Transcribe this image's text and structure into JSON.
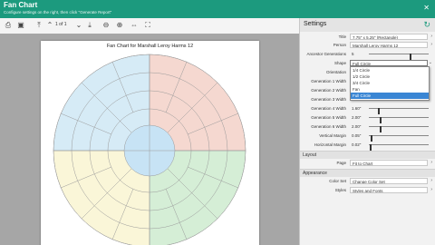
{
  "window": {
    "title": "Fan Chart",
    "subtitle": "Configure settings on the right, then click \"Generate Report\""
  },
  "toolbar": {
    "page_label": "1 of 1"
  },
  "chart": {
    "title": "Fan Chart for Marshall Leroy Harms 12"
  },
  "colors": {
    "accent": "#1c9a7e",
    "center": "#c7e3f5",
    "q1": "#f5d8d0",
    "q2": "#d5eed6",
    "q3": "#faf6d8",
    "q4": "#d6ebf6",
    "dropdown_highlight": "#3a86d4"
  },
  "settings": {
    "header": "Settings",
    "rows": [
      {
        "key": "Title",
        "value": "7.75\" x 5.25\" (Rectangle)"
      },
      {
        "key": "Person",
        "value": "Marshall Leroy Harms 12"
      },
      {
        "key": "Ancestor Generations",
        "value": "5"
      },
      {
        "key": "Shape",
        "value": "Full Circle"
      },
      {
        "key": "Orientation",
        "value": ""
      },
      {
        "key": "Generation 1 Width",
        "value": ""
      },
      {
        "key": "Generation 2 Width",
        "value": ""
      },
      {
        "key": "Generation 3 Width",
        "value": ""
      },
      {
        "key": "Generation 4 Width",
        "value": "1.60\""
      },
      {
        "key": "Generation 5 Width",
        "value": "2.00\""
      },
      {
        "key": "Generation 6 Width",
        "value": "2.00\""
      },
      {
        "key": "Vertical Margin",
        "value": "0.05\""
      },
      {
        "key": "Horizontal Margin",
        "value": "0.02\""
      }
    ],
    "shape_options": [
      "1/4 Circle",
      "1/2 Circle",
      "3/4 Circle",
      "Fan",
      "Full Circle"
    ],
    "layout_section": "Layout",
    "page_key": "Page",
    "page_value": "Fit to Chart",
    "appearance_section": "Appearance",
    "color_set_key": "Color Set",
    "color_set_value": "Change Color Set",
    "styles_key": "Styles",
    "styles_value": "Styles and Fonts"
  }
}
